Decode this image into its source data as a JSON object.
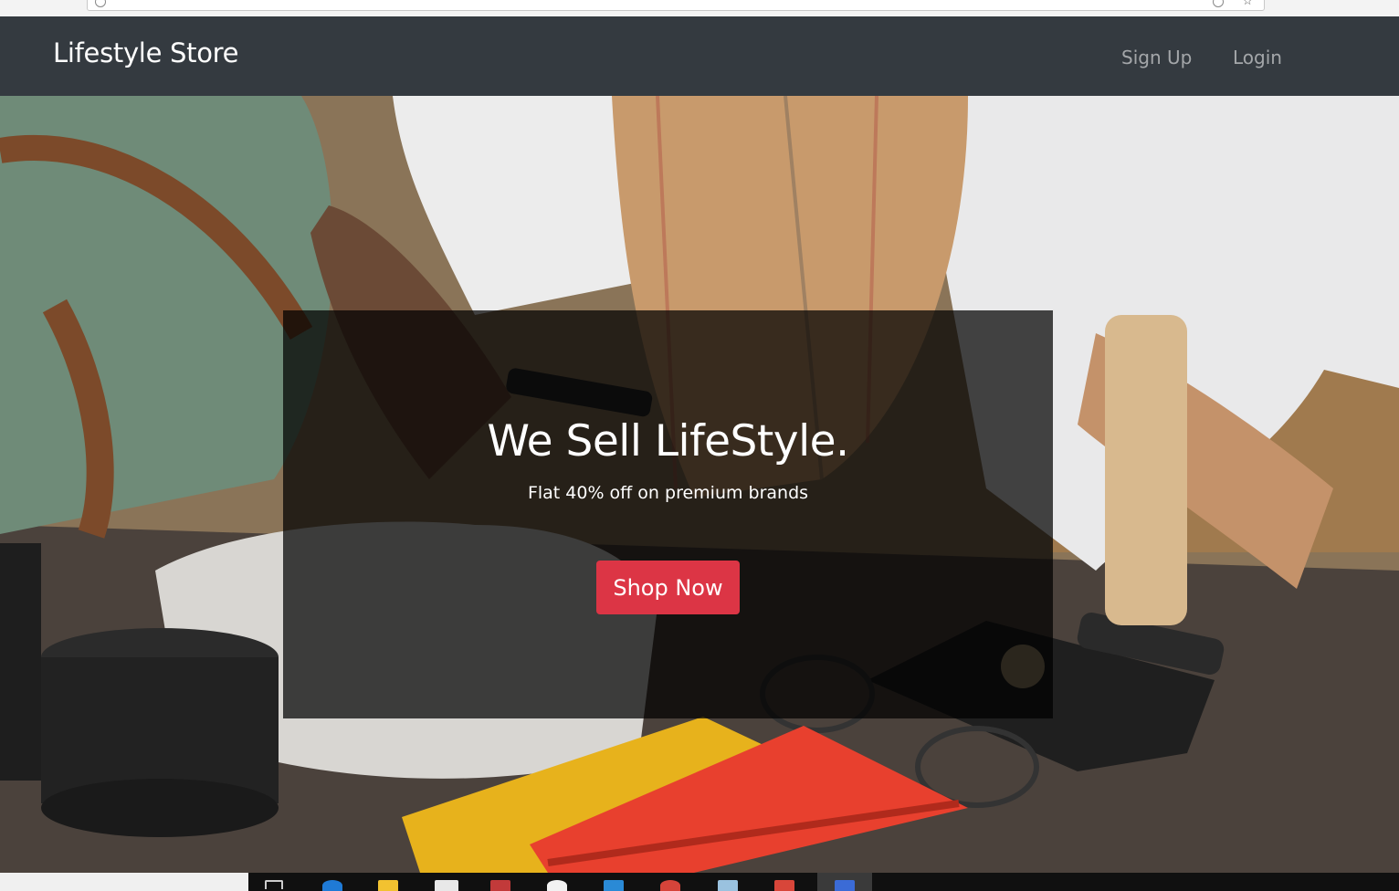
{
  "navbar": {
    "brand": "Lifestyle Store",
    "links": {
      "signup": "Sign Up",
      "login": "Login"
    }
  },
  "hero": {
    "headline": "We Sell LifeStyle.",
    "subline": "Flat 40% off on premium brands",
    "cta": "Shop Now"
  },
  "colors": {
    "navbar_bg": "#343a40",
    "cta_bg": "#dc3545",
    "banner_overlay": "rgba(0,0,0,0.72)"
  },
  "taskbar": {
    "icons": [
      "task-view-icon",
      "edge-icon",
      "file-explorer-icon",
      "store-icon",
      "app-icon",
      "app-icon",
      "vscode-icon",
      "chrome-icon",
      "app-icon",
      "app-icon",
      "app-icon"
    ]
  }
}
